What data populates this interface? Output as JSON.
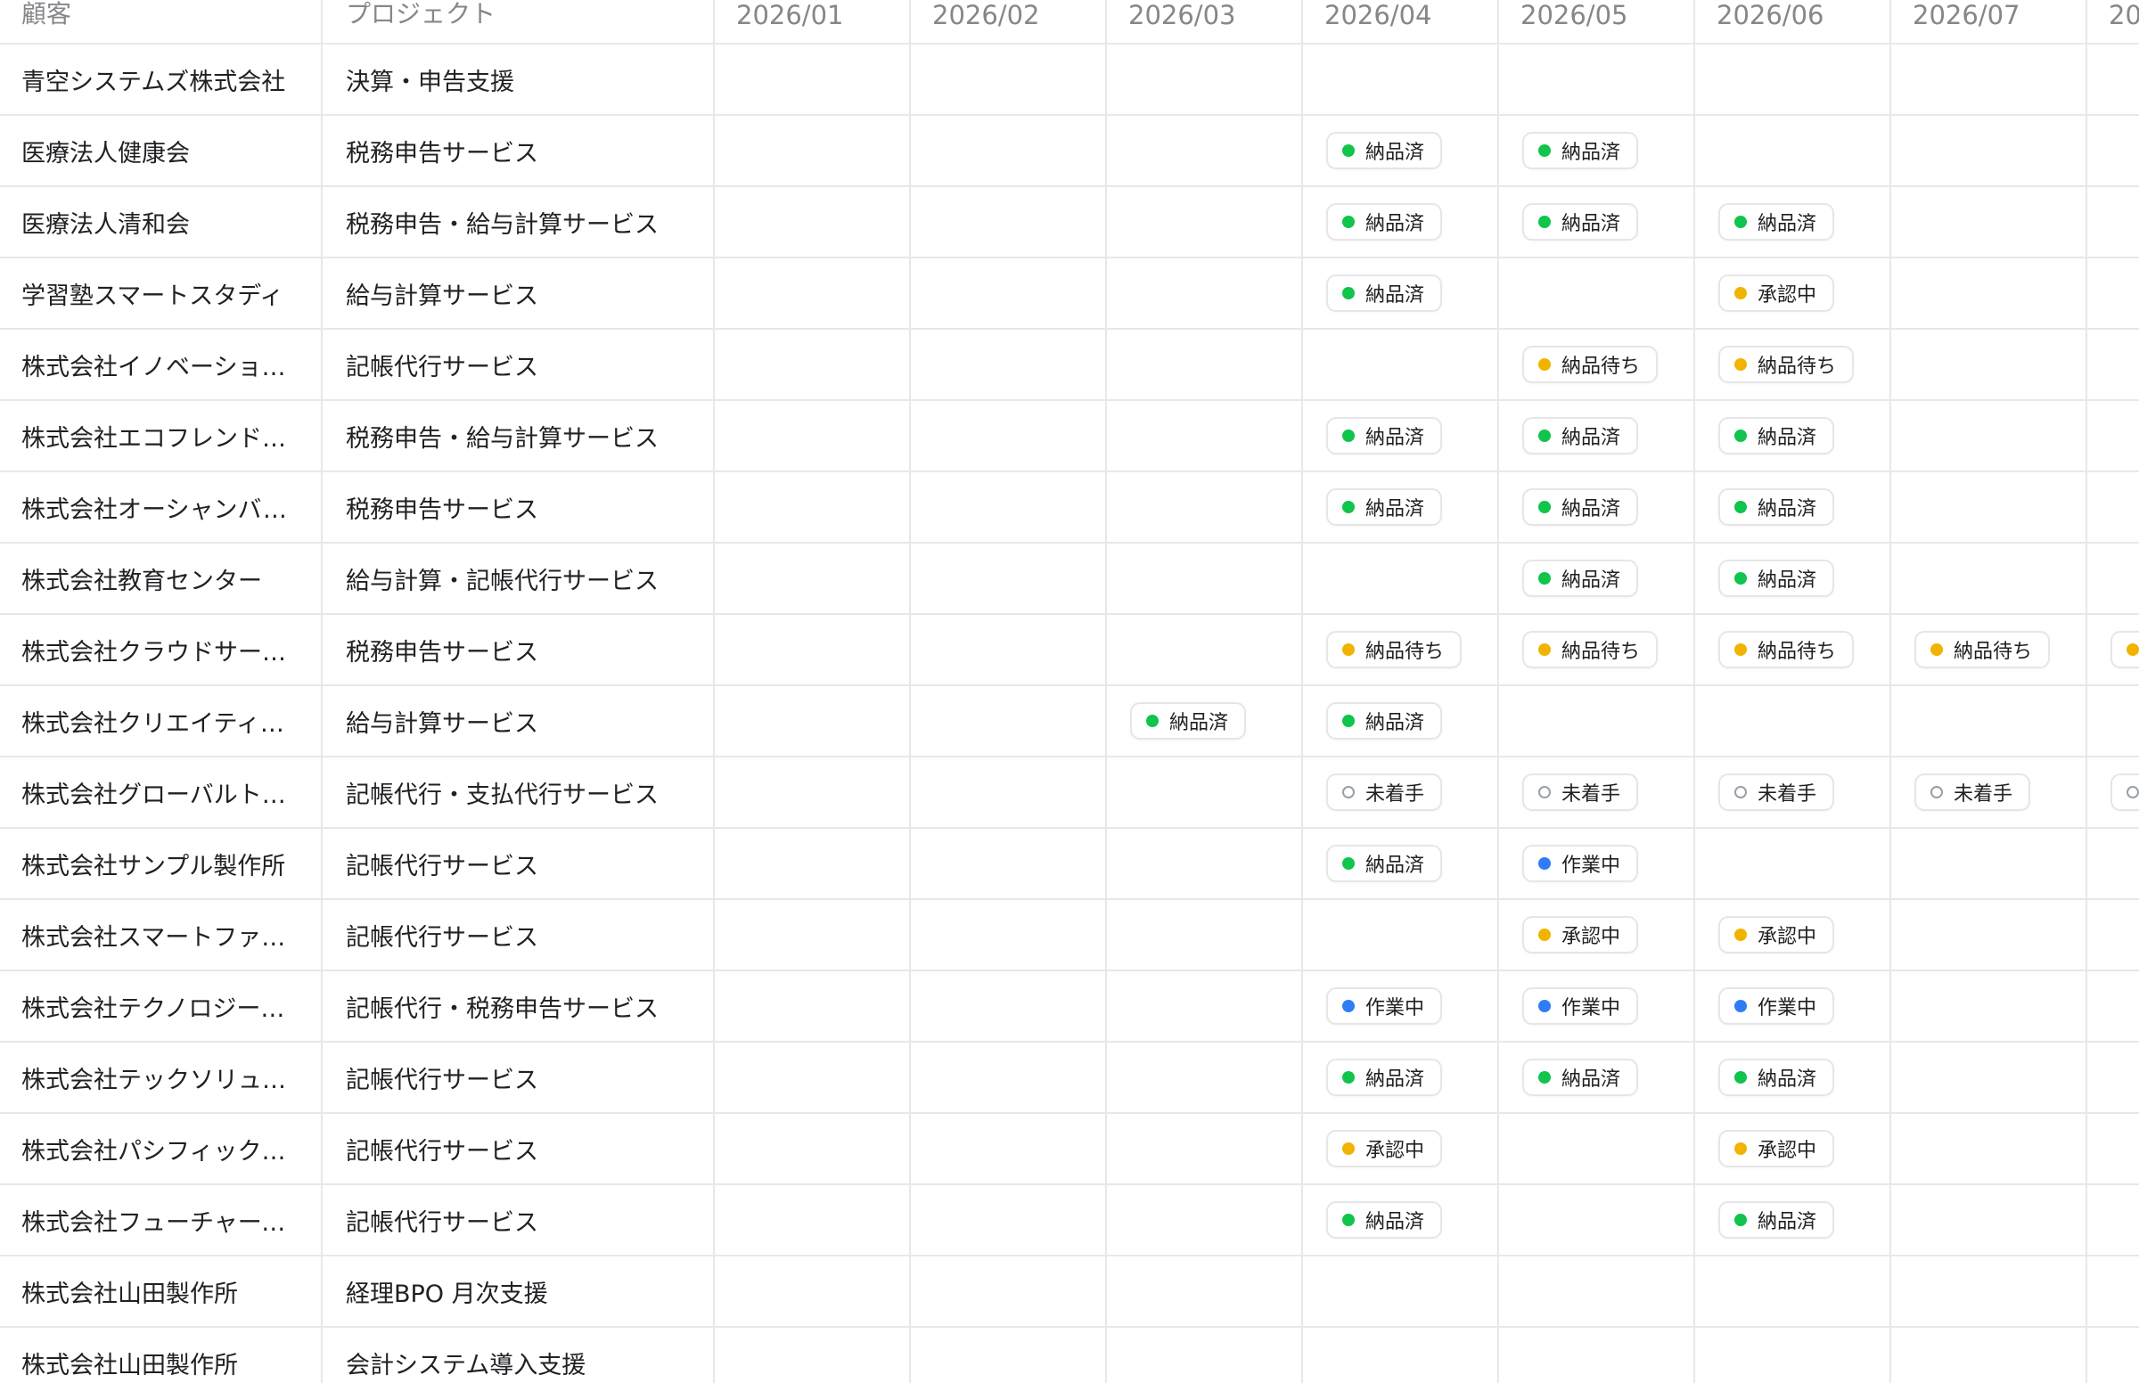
{
  "columns": {
    "customer": "顧客",
    "project": "プロジェクト",
    "months": [
      "2026/01",
      "2026/02",
      "2026/03",
      "2026/04",
      "2026/05",
      "2026/06",
      "2026/07",
      "20"
    ]
  },
  "status_colors": {
    "納品済": "#10c44c",
    "承認中": "#f0b400",
    "納品待ち": "#f0b400",
    "作業中": "#2f7cf6",
    "未着手": "#9aa0a6"
  },
  "rows": [
    {
      "customer": "青空システムズ株式会社",
      "project": "決算・申告支援",
      "months": [
        null,
        null,
        null,
        null,
        null,
        null,
        null,
        null
      ]
    },
    {
      "customer": "医療法人健康会",
      "project": "税務申告サービス",
      "months": [
        null,
        null,
        null,
        "納品済",
        "納品済",
        null,
        null,
        null
      ]
    },
    {
      "customer": "医療法人清和会",
      "project": "税務申告・給与計算サービス",
      "months": [
        null,
        null,
        null,
        "納品済",
        "納品済",
        "納品済",
        null,
        null
      ]
    },
    {
      "customer": "学習塾スマートスタディ",
      "project": "給与計算サービス",
      "months": [
        null,
        null,
        null,
        "納品済",
        null,
        "承認中",
        null,
        null
      ]
    },
    {
      "customer": "株式会社イノベーション…",
      "project": "記帳代行サービス",
      "months": [
        null,
        null,
        null,
        null,
        "納品待ち",
        "納品待ち",
        null,
        null
      ]
    },
    {
      "customer": "株式会社エコフレンドリ…",
      "project": "税務申告・給与計算サービス",
      "months": [
        null,
        null,
        null,
        "納品済",
        "納品済",
        "納品済",
        null,
        null
      ]
    },
    {
      "customer": "株式会社オーシャンバン…",
      "project": "税務申告サービス",
      "months": [
        null,
        null,
        null,
        "納品済",
        "納品済",
        "納品済",
        null,
        null
      ]
    },
    {
      "customer": "株式会社教育センター",
      "project": "給与計算・記帳代行サービス",
      "months": [
        null,
        null,
        null,
        null,
        "納品済",
        "納品済",
        null,
        null
      ]
    },
    {
      "customer": "株式会社クラウドサービ…",
      "project": "税務申告サービス",
      "months": [
        null,
        null,
        null,
        "納品待ち",
        "納品待ち",
        "納品待ち",
        "納品待ち",
        ""
      ]
    },
    {
      "customer": "株式会社クリエイティブ…",
      "project": "給与計算サービス",
      "months": [
        null,
        null,
        "納品済",
        "納品済",
        null,
        null,
        null,
        null
      ]
    },
    {
      "customer": "株式会社グローバルトレ…",
      "project": "記帳代行・支払代行サービス",
      "months": [
        null,
        null,
        null,
        "未着手",
        "未着手",
        "未着手",
        "未着手",
        ""
      ]
    },
    {
      "customer": "株式会社サンプル製作所",
      "project": "記帳代行サービス",
      "months": [
        null,
        null,
        null,
        "納品済",
        "作業中",
        null,
        null,
        null
      ]
    },
    {
      "customer": "株式会社スマートファー…",
      "project": "記帳代行サービス",
      "months": [
        null,
        null,
        null,
        null,
        "承認中",
        "承認中",
        null,
        null
      ]
    },
    {
      "customer": "株式会社テクノロジーコ…",
      "project": "記帳代行・税務申告サービス",
      "months": [
        null,
        null,
        null,
        "作業中",
        "作業中",
        "作業中",
        null,
        null
      ]
    },
    {
      "customer": "株式会社テックソリュー…",
      "project": "記帳代行サービス",
      "months": [
        null,
        null,
        null,
        "納品済",
        "納品済",
        "納品済",
        null,
        null
      ]
    },
    {
      "customer": "株式会社パシフィック建…",
      "project": "記帳代行サービス",
      "months": [
        null,
        null,
        null,
        "承認中",
        null,
        "承認中",
        null,
        null
      ]
    },
    {
      "customer": "株式会社フューチャーシ…",
      "project": "記帳代行サービス",
      "months": [
        null,
        null,
        null,
        "納品済",
        null,
        "納品済",
        null,
        null
      ]
    },
    {
      "customer": "株式会社山田製作所",
      "project": "経理BPO 月次支援",
      "months": [
        null,
        null,
        null,
        null,
        null,
        null,
        null,
        null
      ]
    },
    {
      "customer": "株式会社山田製作所",
      "project": "会計システム導入支援",
      "months": [
        null,
        null,
        null,
        null,
        null,
        null,
        null,
        null
      ]
    }
  ]
}
